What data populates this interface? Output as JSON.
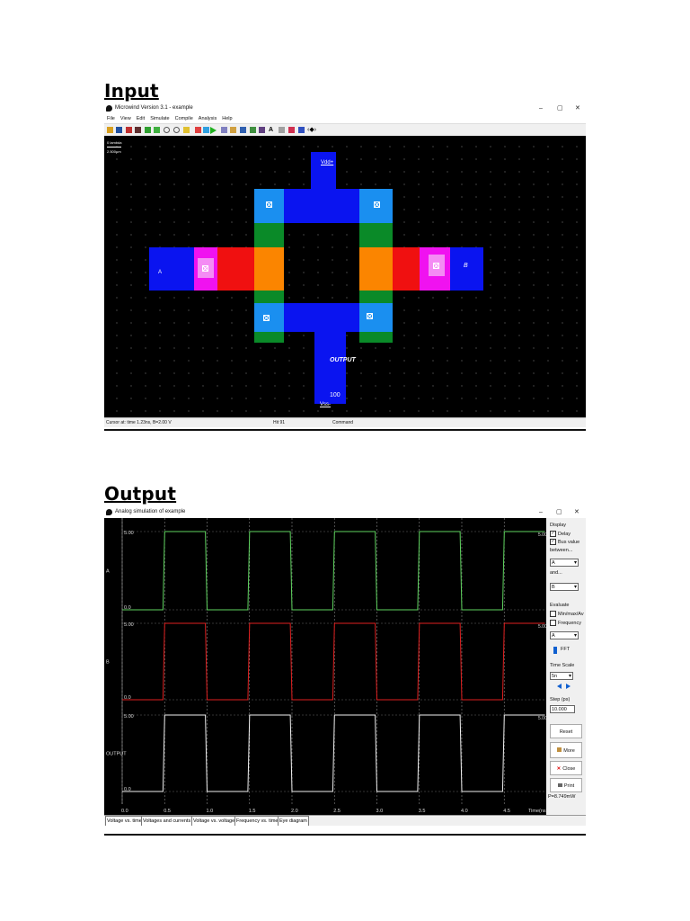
{
  "headings": {
    "input": "Input",
    "output": "Output"
  },
  "input_window": {
    "title": "Microwind Version 3.1 - example",
    "menu": [
      "File",
      "View",
      "Edit",
      "Simulate",
      "Compile",
      "Analysis",
      "Help"
    ],
    "scale_label_1": "0 lambda",
    "scale_label_2": "2.500µm",
    "labels": {
      "vdd": "Vdd+",
      "a": "A",
      "b": "B",
      "output": "OUTPUT",
      "vss": "Vss-",
      "hundred": "100"
    },
    "status": {
      "cursor": "Cursor at: time 1.23ns, B=2.00 V",
      "hit": "Hit 91",
      "command": "Command"
    },
    "window_controls": {
      "minimize": "–",
      "maximize": "▢",
      "close": "✕"
    }
  },
  "output_window": {
    "title": "Analog simulation of example",
    "window_controls": {
      "minimize": "–",
      "maximize": "▢",
      "close": "✕"
    },
    "chart_data": {
      "type": "line",
      "x_unit": "Time(ns)",
      "x_ticks": [
        "0.0",
        "0.5",
        "1.0",
        "1.5",
        "2.0",
        "2.5",
        "3.0",
        "3.5",
        "4.0",
        "4.5"
      ],
      "y_range_label_high": "5.00",
      "y_range_label_low": "0.0",
      "series": [
        {
          "name": "A",
          "color": "#5fd35f",
          "high_label": "5.00",
          "low_label": "0.0",
          "points": [
            [
              0.0,
              0
            ],
            [
              0.48,
              0
            ],
            [
              0.5,
              5
            ],
            [
              0.98,
              5
            ],
            [
              1.0,
              0
            ],
            [
              1.48,
              0
            ],
            [
              1.5,
              5
            ],
            [
              1.98,
              5
            ],
            [
              2.0,
              0
            ],
            [
              2.48,
              0
            ],
            [
              2.5,
              5
            ],
            [
              2.98,
              5
            ],
            [
              3.0,
              0
            ],
            [
              3.48,
              0
            ],
            [
              3.5,
              5
            ],
            [
              3.98,
              5
            ],
            [
              4.0,
              0
            ],
            [
              4.48,
              0
            ],
            [
              4.5,
              5
            ],
            [
              4.98,
              5
            ]
          ]
        },
        {
          "name": "B",
          "color": "#e02020",
          "high_label": "5.00",
          "low_label": "0.0",
          "points": [
            [
              0.0,
              0
            ],
            [
              0.48,
              0
            ],
            [
              0.5,
              5
            ],
            [
              0.98,
              5
            ],
            [
              1.0,
              0
            ],
            [
              1.48,
              0
            ],
            [
              1.5,
              5
            ],
            [
              1.98,
              5
            ],
            [
              2.0,
              0
            ],
            [
              2.48,
              0
            ],
            [
              2.5,
              5
            ],
            [
              2.98,
              5
            ],
            [
              3.0,
              0
            ],
            [
              3.48,
              0
            ],
            [
              3.5,
              5
            ],
            [
              3.98,
              5
            ],
            [
              4.0,
              0
            ],
            [
              4.48,
              0
            ],
            [
              4.5,
              5
            ],
            [
              4.98,
              5
            ]
          ]
        },
        {
          "name": "OUTPUT",
          "color": "#f0f0f0",
          "high_label": "5.00",
          "low_label": "0.0",
          "points": [
            [
              0.0,
              0
            ],
            [
              0.48,
              0
            ],
            [
              0.5,
              5
            ],
            [
              0.98,
              5
            ],
            [
              1.0,
              0
            ],
            [
              1.48,
              0
            ],
            [
              1.5,
              5
            ],
            [
              1.98,
              5
            ],
            [
              2.0,
              0
            ],
            [
              2.48,
              0
            ],
            [
              2.5,
              5
            ],
            [
              2.98,
              5
            ],
            [
              3.0,
              0
            ],
            [
              3.48,
              0
            ],
            [
              3.5,
              5
            ],
            [
              3.98,
              5
            ],
            [
              4.0,
              0
            ],
            [
              4.48,
              0
            ],
            [
              4.5,
              5
            ],
            [
              4.98,
              5
            ]
          ]
        }
      ],
      "right_labels": [
        "5.00",
        "5.00",
        "5.00"
      ]
    },
    "panel": {
      "display": "Display",
      "delay": "Delay",
      "bus_value": "Bus value",
      "between": "between...",
      "between_value": "A",
      "and": "and...",
      "and_value": "B",
      "evaluate": "Evaluate",
      "minmax": "Min/max/Av",
      "frequency": "Frequency",
      "eval_value": "A",
      "fft": "FFT",
      "time_scale": "Time Scale",
      "time_scale_value": "5n",
      "step": "Step (ps)",
      "step_value": "10.000",
      "reset": "Reset",
      "more": "More",
      "close": "Close",
      "print": "Print",
      "power": "P=8.749mW"
    },
    "tabs": [
      "Voltage vs. time",
      "Voltages and currents",
      "Voltage vs. voltage",
      "Frequency vs. time",
      "Eye diagram"
    ]
  }
}
